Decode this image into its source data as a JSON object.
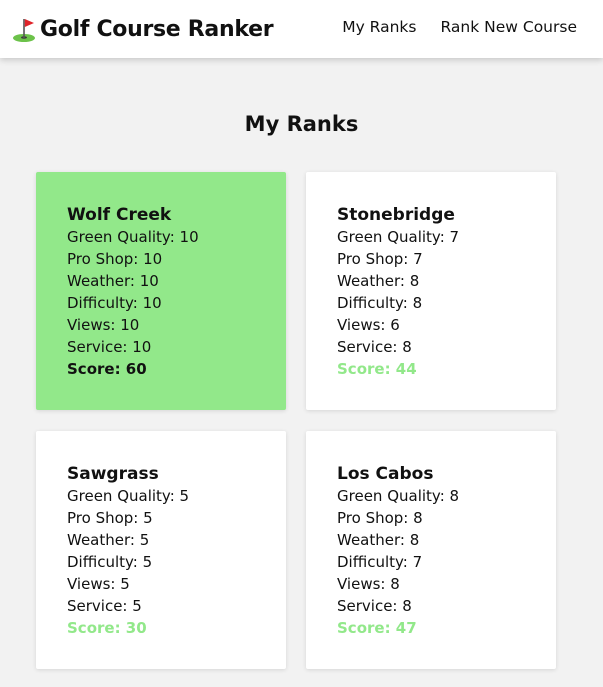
{
  "header": {
    "flag_emoji": "⛳",
    "brand": "Golf Course Ranker",
    "nav": [
      {
        "label": "My Ranks"
      },
      {
        "label": "Rank New Course"
      }
    ]
  },
  "page": {
    "title": "My Ranks"
  },
  "colors": {
    "top_card_bg": "#92e88a",
    "score_green": "#92e88a",
    "card_bg": "#ffffff",
    "page_bg": "#f2f2f2"
  },
  "courses": [
    {
      "name": "Wolf Creek",
      "green_quality": "Green Quality: 10",
      "pro_shop": "Pro Shop: 10",
      "weather": "Weather: 10",
      "difficulty": "Difficulty: 10",
      "views": "Views: 10",
      "service": "Service: 10",
      "score": "Score: 60"
    },
    {
      "name": "Stonebridge",
      "green_quality": "Green Quality: 7",
      "pro_shop": "Pro Shop: 7",
      "weather": "Weather: 8",
      "difficulty": "Difficulty: 8",
      "views": "Views: 6",
      "service": "Service: 8",
      "score": "Score: 44"
    },
    {
      "name": "Sawgrass",
      "green_quality": "Green Quality: 5",
      "pro_shop": "Pro Shop: 5",
      "weather": "Weather: 5",
      "difficulty": "Difficulty: 5",
      "views": "Views: 5",
      "service": "Service: 5",
      "score": "Score: 30"
    },
    {
      "name": "Los Cabos",
      "green_quality": "Green Quality: 8",
      "pro_shop": "Pro Shop: 8",
      "weather": "Weather: 8",
      "difficulty": "Difficulty: 7",
      "views": "Views: 8",
      "service": "Service: 8",
      "score": "Score: 47"
    }
  ]
}
